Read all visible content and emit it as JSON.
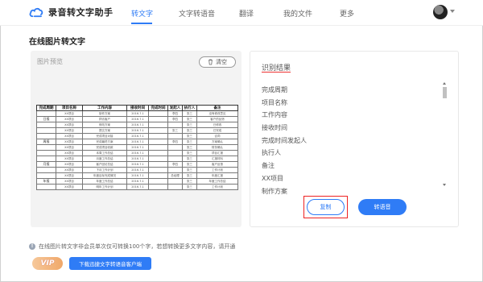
{
  "app": {
    "name": "录音转文字助手"
  },
  "nav": {
    "items": [
      {
        "label": "转文字",
        "active": true
      },
      {
        "label": "文字转语音",
        "active": false
      },
      {
        "label": "翻译",
        "active": false
      },
      {
        "label": "我的文件",
        "active": false
      },
      {
        "label": "更多",
        "active": false
      }
    ]
  },
  "page": {
    "title": "在线图片转文字"
  },
  "preview": {
    "label": "图片预览",
    "clear_label": "清空",
    "table": {
      "headers": [
        "完成周期",
        "项目名称",
        "工作内容",
        "接收时间",
        "完成时间",
        "发起人",
        "执行人",
        "备注"
      ],
      "rows": [
        [
          "",
          "XX项目",
          "制作方案",
          "2016.7.1",
          "",
          "李四",
          "张三",
          "没有修改意见"
        ],
        [
          "日报",
          "XX项目",
          "拜访客户",
          "2016.7.1",
          "",
          "李四",
          "张三",
          "客户的反馈"
        ],
        [
          "",
          "XX项目",
          "修改方案",
          "2016.7.1",
          "",
          "",
          "张三",
          "已修改"
        ],
        [
          "",
          "XX项目",
          "提交方案",
          "2016.7.1",
          "",
          "张三",
          "张三",
          "已完成"
        ],
        [
          "",
          "XX项目",
          "完成项目对接",
          "2016.7.1",
          "",
          "",
          "张三",
          "合同"
        ],
        [
          "周报",
          "XX项目",
          "完成最终方案",
          "2016.7.1",
          "",
          "李四",
          "张三",
          "方案确认"
        ],
        [
          "",
          "XX项目",
          "完成项目收款",
          "2016.7.1",
          "",
          "",
          "张三",
          "财务确认"
        ],
        [
          "",
          "XX项目",
          "本周工作总结",
          "2016.7.1",
          "",
          "",
          "张三",
          "项目汇报"
        ],
        [
          "",
          "XX项目",
          "月度工作总结",
          "2016.7.1",
          "",
          "",
          "张三",
          "汇报材料"
        ],
        [
          "月报",
          "XX项目",
          "客户回访总结",
          "2016.7.1",
          "",
          "李四",
          "张三",
          "客户反馈"
        ],
        [
          "",
          "XX项目",
          "下月工作计划",
          "2016.7.1",
          "",
          "",
          "张三",
          "工作计划"
        ],
        [
          "",
          "XX项目",
          "年度目标完成情况",
          "2016.7.1",
          "",
          "总经理",
          "张三",
          "年度汇报"
        ],
        [
          "年报",
          "XX项目",
          "年度工作总结",
          "2016.7.1",
          "",
          "",
          "张三",
          "年度工作总结"
        ],
        [
          "",
          "XX项目",
          "明年工作计划",
          "2016.7.1",
          "",
          "",
          "张三",
          "工作计划"
        ]
      ]
    }
  },
  "result": {
    "title": "识别结果",
    "items": [
      "完成周期",
      "项目名称",
      "工作内容",
      "接收时间",
      "完成时间发起人",
      "执行人",
      "备注",
      "XX项目",
      "制作方案"
    ],
    "copy_label": "复制",
    "voice_label": "转语音"
  },
  "footer": {
    "notice": "在线图片转文字非会员单次仅可转换100个字，若想转换更多文字内容，请开通",
    "vip_label": "VIP",
    "download_label": "下载迅捷文字转语音客户端"
  },
  "colors": {
    "accent": "#2f7cf6",
    "highlight": "#e22222"
  }
}
